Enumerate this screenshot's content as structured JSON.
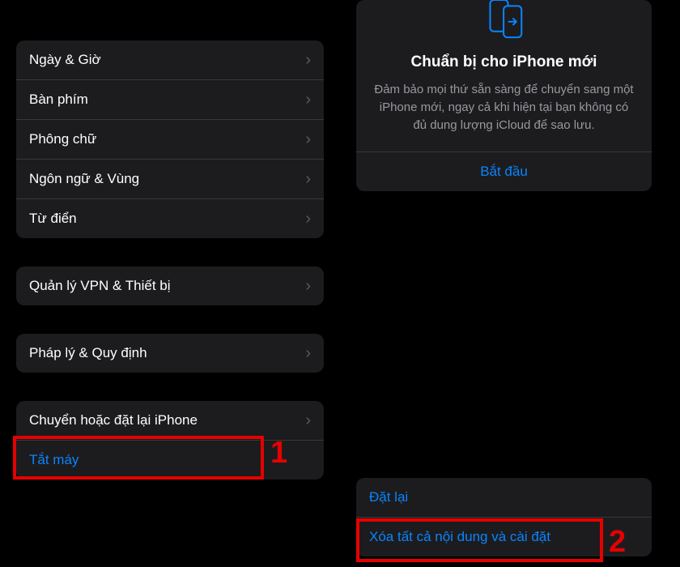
{
  "left": {
    "group1": [
      {
        "label": "Ngày & Giờ"
      },
      {
        "label": "Bàn phím"
      },
      {
        "label": "Phông chữ"
      },
      {
        "label": "Ngôn ngữ & Vùng"
      },
      {
        "label": "Từ điển"
      }
    ],
    "group2": [
      {
        "label": "Quản lý VPN & Thiết bị"
      }
    ],
    "group3": [
      {
        "label": "Pháp lý & Quy định"
      }
    ],
    "group4": [
      {
        "label": "Chuyển hoặc đặt lại iPhone",
        "chevron": true,
        "blue": false
      },
      {
        "label": "Tắt máy",
        "chevron": false,
        "blue": true
      }
    ]
  },
  "prepare": {
    "title": "Chuẩn bị cho iPhone mới",
    "desc": "Đảm bảo mọi thứ sẵn sàng để chuyển sang một iPhone mới, ngay cả khi hiện tại bạn không có đủ dung lượng iCloud để sao lưu.",
    "action": "Bắt đầu"
  },
  "bottom_actions": [
    {
      "label": "Đặt lại"
    },
    {
      "label": "Xóa tất cả nội dung và cài đặt"
    }
  ],
  "annotations": {
    "marker1": "1",
    "marker2": "2"
  }
}
